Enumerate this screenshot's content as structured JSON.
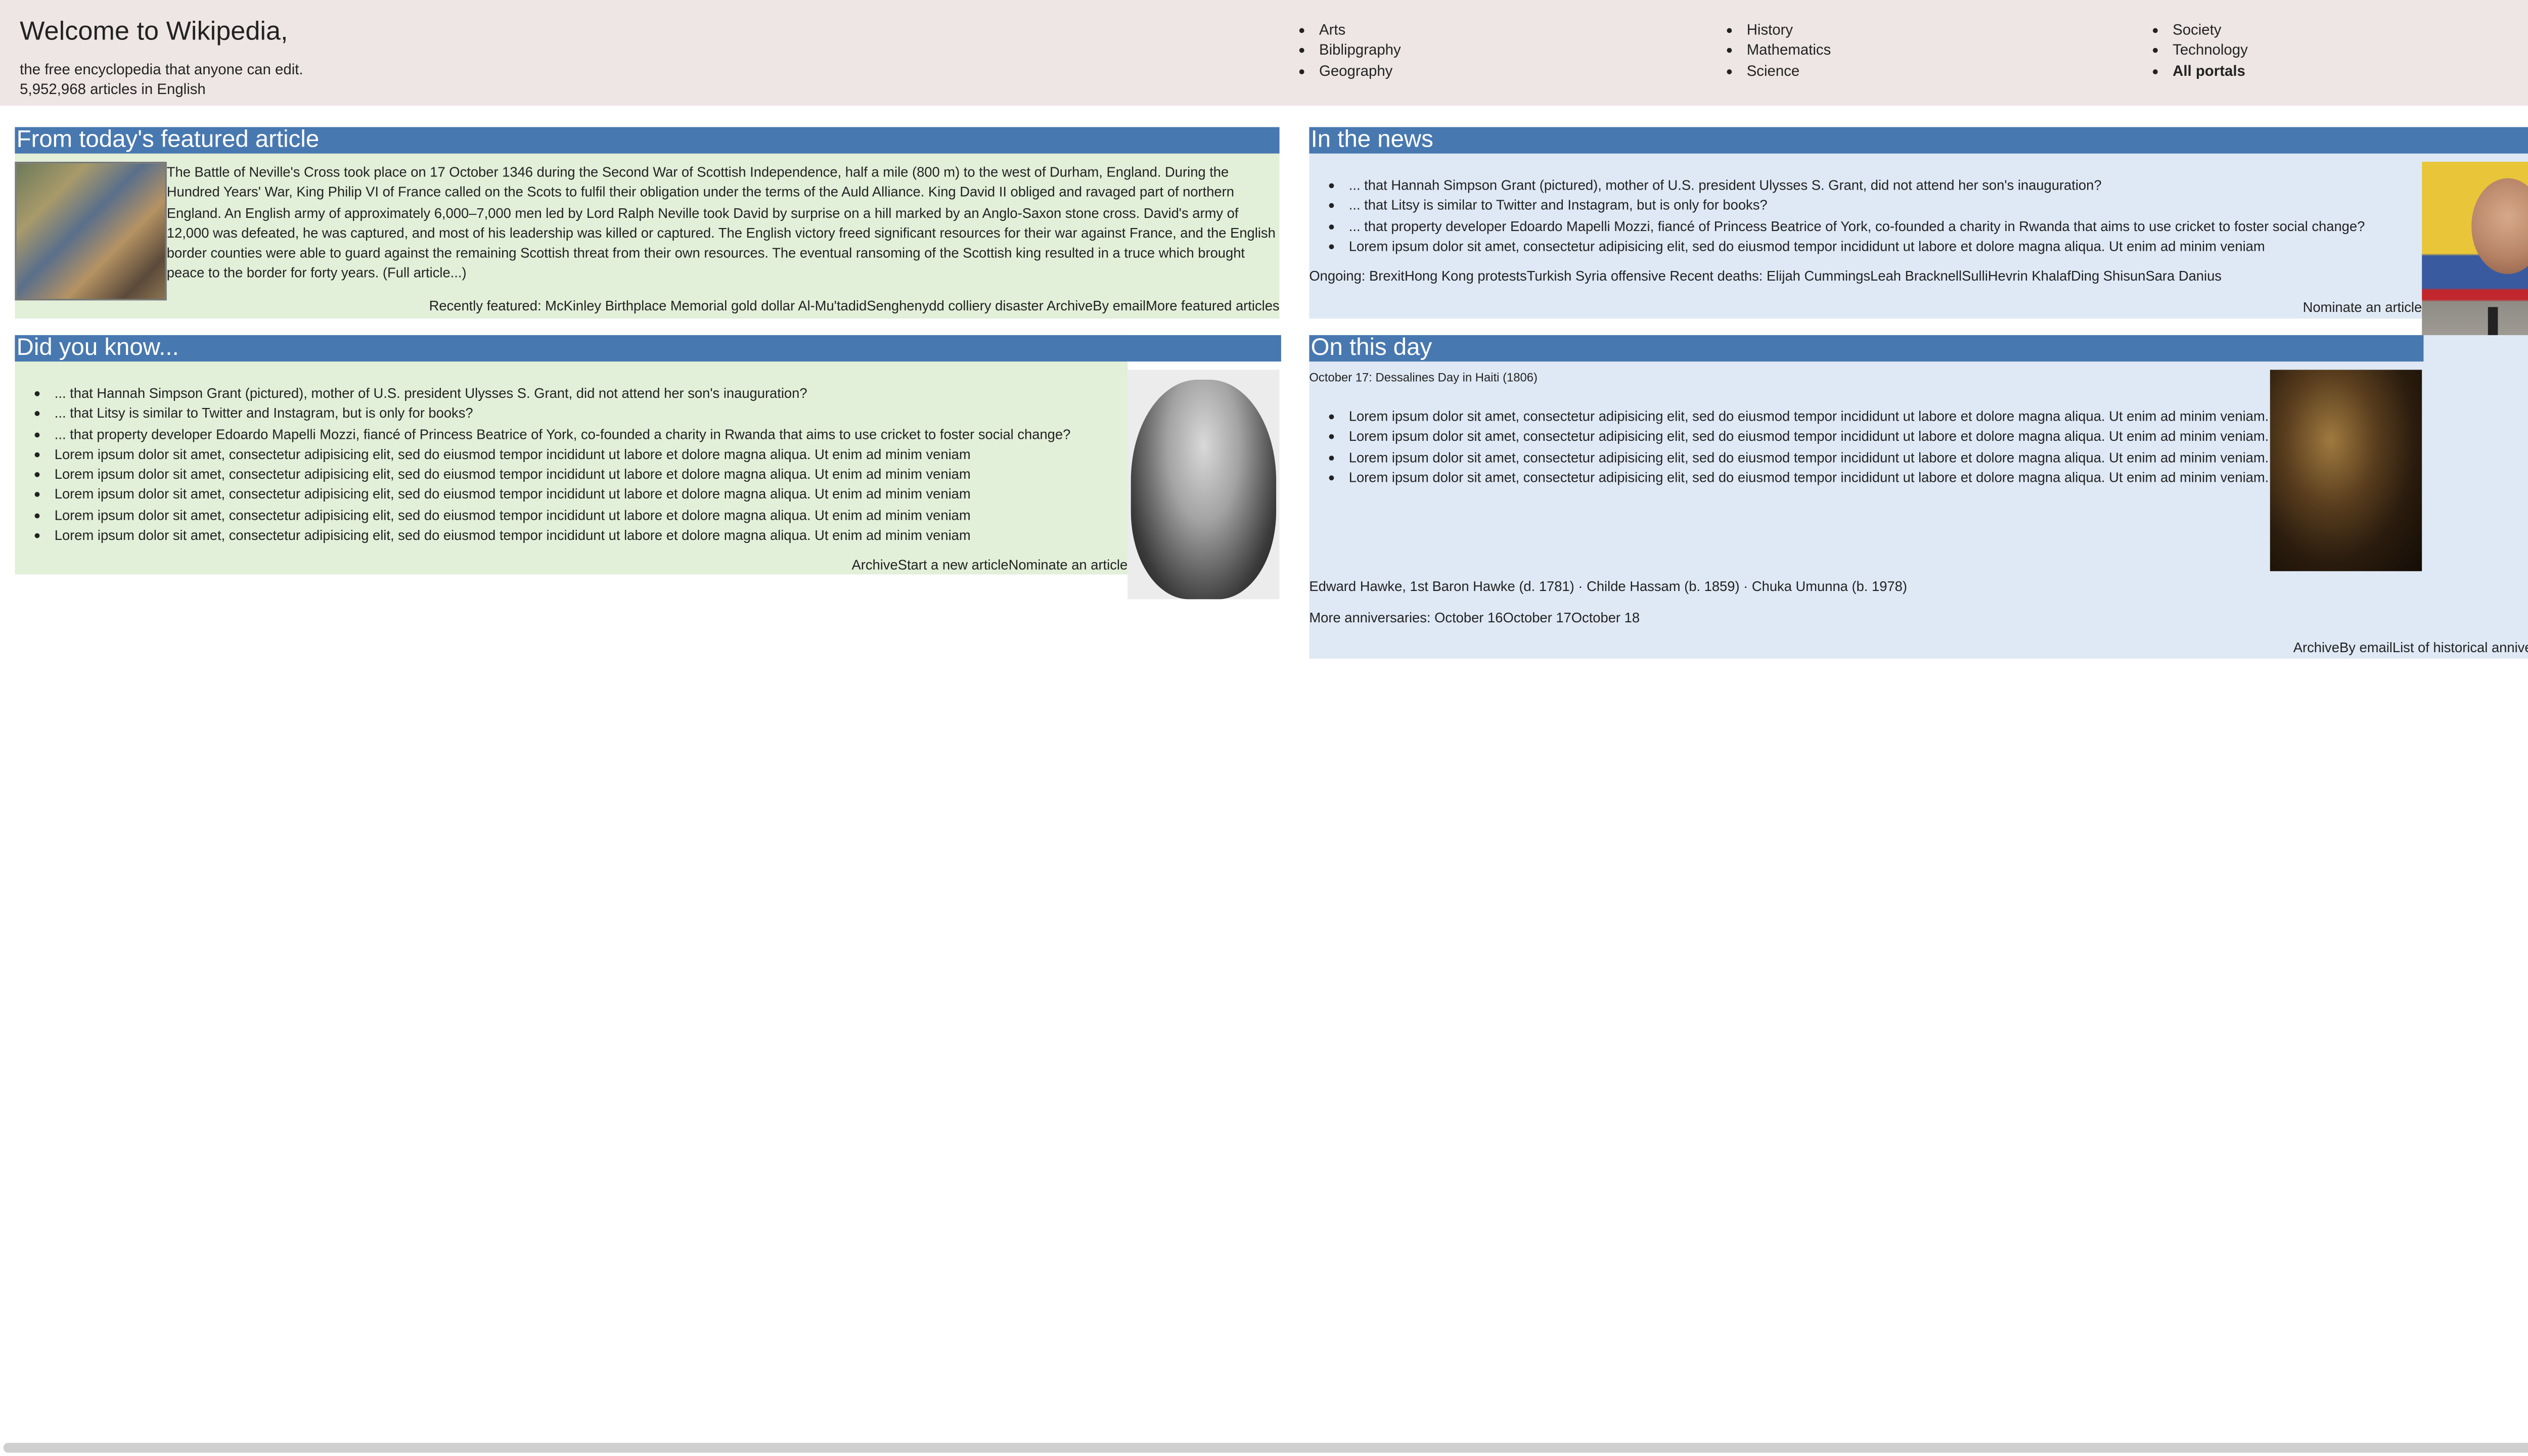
{
  "header": {
    "title": "Welcome to Wikipedia,",
    "tagline": "the free encyclopedia that anyone can edit.",
    "article_count": "5,952,968 articles in English"
  },
  "portals": {
    "col1": [
      "Arts",
      "Biblipgraphy",
      "Geography"
    ],
    "col2": [
      "History",
      "Mathematics",
      "Science"
    ],
    "col3": [
      "Society",
      "Technology",
      "All portals"
    ]
  },
  "featured": {
    "heading": "From today's featured article",
    "text": "The Battle of Neville's Cross took place on 17 October 1346 during the Second War of Scottish Independence, half a mile (800 m) to the west of Durham, England. During the Hundred Years' War, King Philip VI of France called on the Scots to fulfil their obligation under the terms of the Auld Alliance. King David II obliged and ravaged part of northern England. An English army of approximately 6,000–7,000 men led by Lord Ralph Neville took David by surprise on a hill marked by an Anglo-Saxon stone cross. David's army of 12,000 was defeated, he was captured, and most of his leadership was killed or captured. The English victory freed significant resources for their war against France, and the English border counties were able to guard against the remaining Scottish threat from their own resources. The eventual ransoming of the Scottish king resulted in a truce which brought peace to the border for forty years. (Full article...)",
    "recently_label": "Recently featured: ",
    "recently": [
      "McKinley Birthplace Memorial gold dollar",
      "Al-Mu'tadid",
      "Senghenydd colliery disaster"
    ],
    "links": [
      "Archive",
      "By email",
      "More featured articles"
    ]
  },
  "dyk": {
    "heading": "Did you know...",
    "items": [
      "... that Hannah Simpson Grant (pictured), mother of U.S. president Ulysses S. Grant, did not attend her son's inauguration?",
      "... that Litsy is similar to Twitter and Instagram, but is only for books?",
      "... that property developer Edoardo Mapelli Mozzi, fiancé of Princess Beatrice of York, co-founded a charity in Rwanda that aims to use cricket to foster social change?",
      "Lorem ipsum dolor sit amet, consectetur adipisicing elit, sed do eiusmod tempor incididunt ut labore et dolore magna aliqua. Ut enim ad minim veniam",
      "Lorem ipsum dolor sit amet, consectetur adipisicing elit, sed do eiusmod tempor incididunt ut labore et dolore magna aliqua. Ut enim ad minim veniam",
      "Lorem ipsum dolor sit amet, consectetur adipisicing elit, sed do eiusmod tempor incididunt ut labore et dolore magna aliqua. Ut enim ad minim veniam",
      "Lorem ipsum dolor sit amet, consectetur adipisicing elit, sed do eiusmod tempor incididunt ut labore et dolore magna aliqua. Ut enim ad minim veniam",
      "Lorem ipsum dolor sit amet, consectetur adipisicing elit, sed do eiusmod tempor incididunt ut labore et dolore magna aliqua. Ut enim ad minim veniam"
    ],
    "links": [
      "Archive",
      "Start a new article",
      "Nominate an article"
    ]
  },
  "news": {
    "heading": "In the news",
    "items": [
      "... that Hannah Simpson Grant (pictured), mother of U.S. president Ulysses S. Grant, did not attend her son's inauguration?",
      "... that Litsy is similar to Twitter and Instagram, but is only for books?",
      "... that property developer Edoardo Mapelli Mozzi, fiancé of Princess Beatrice of York, co-founded a charity in Rwanda that aims to use cricket to foster social change?",
      "Lorem ipsum dolor sit amet, consectetur adipisicing elit, sed do eiusmod tempor incididunt ut labore et dolore magna aliqua. Ut enim ad minim veniam"
    ],
    "ongoing_label": "Ongoing: ",
    "ongoing": [
      "Brexit",
      "Hong Kong protests",
      "Turkish Syria offensive"
    ],
    "deaths_label": " Recent deaths: ",
    "deaths": [
      "Elijah Cummings",
      "Leah Bracknell",
      "Sulli",
      "Hevrin Khalaf",
      "Ding Shisun",
      "Sara Danius"
    ],
    "nominate": "Nominate an article"
  },
  "otd": {
    "heading": "On this day",
    "date_line": "October 17: Dessalines Day in Haiti (1806)",
    "items": [
      "Lorem ipsum dolor sit amet, consectetur adipisicing elit, sed do eiusmod tempor incididunt ut labore et dolore magna aliqua. Ut enim ad minim veniam.",
      "Lorem ipsum dolor sit amet, consectetur adipisicing elit, sed do eiusmod tempor incididunt ut labore et dolore magna aliqua. Ut enim ad minim veniam.",
      "Lorem ipsum dolor sit amet, consectetur adipisicing elit, sed do eiusmod tempor incididunt ut labore et dolore magna aliqua. Ut enim ad minim veniam.",
      "Lorem ipsum dolor sit amet, consectetur adipisicing elit, sed do eiusmod tempor incididunt ut labore et dolore magna aliqua. Ut enim ad minim veniam."
    ],
    "births": "Edward Hawke, 1st Baron Hawke (d. 1781) · Childe Hassam (b. 1859) · Chuka Umunna (b. 1978)",
    "more_label": "More anniversaries: ",
    "more": [
      "October 16",
      "October 17",
      "October 18"
    ],
    "links": [
      "Archive",
      "By email",
      "List of historical anniversaries"
    ]
  },
  "colors": {
    "header_bg": "#ede6e4",
    "section_heading_bg": "#4878b0",
    "green_panel": "#e2efd9",
    "blue_panel": "#dfe9f5"
  }
}
